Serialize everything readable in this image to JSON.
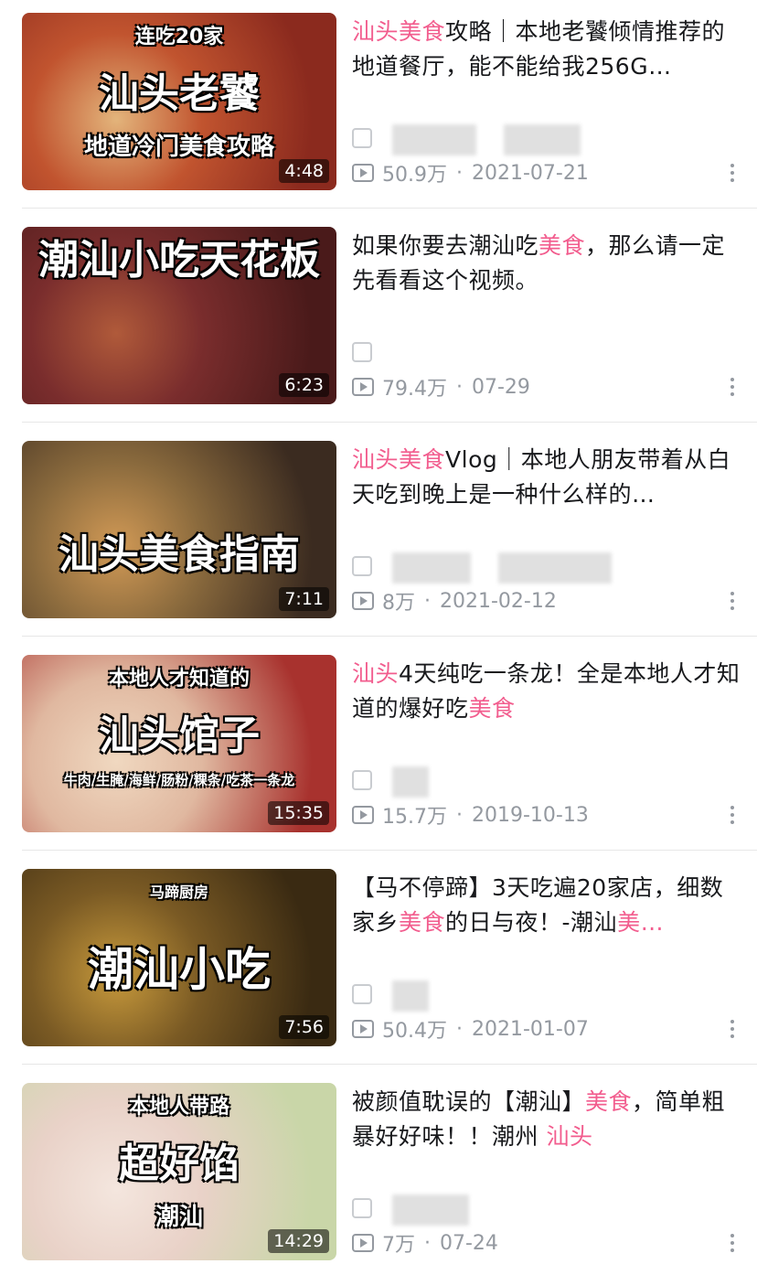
{
  "videos": [
    {
      "title_parts": [
        {
          "t": "汕头美食",
          "hl": true
        },
        {
          "t": "攻略｜本地老饕倾情推荐的地道餐厅，能不能给我256G…",
          "hl": false
        }
      ],
      "thumb_lines": [
        "连吃20家",
        "汕头老饕",
        "地道冷门美食攻略"
      ],
      "duration": "4:48",
      "views": "50.9万",
      "date": "2021-07-21",
      "colors": [
        "#8b2a1e",
        "#c1542f",
        "#e3b47b"
      ]
    },
    {
      "title_parts": [
        {
          "t": "如果你要去潮汕吃",
          "hl": false
        },
        {
          "t": "美食",
          "hl": true
        },
        {
          "t": "，那么请一定先看看这个视频。",
          "hl": false
        }
      ],
      "thumb_lines": [
        "潮汕小吃天花板"
      ],
      "duration": "6:23",
      "views": "79.4万",
      "date": "07-29",
      "colors": [
        "#4a1a1a",
        "#7a2d2d",
        "#b05a3a"
      ]
    },
    {
      "title_parts": [
        {
          "t": "汕头美食",
          "hl": true
        },
        {
          "t": "Vlog｜本地人朋友带着从白天吃到晚上是一种什么样的…",
          "hl": false
        }
      ],
      "thumb_lines": [
        "汕头美食指南"
      ],
      "duration": "7:11",
      "views": "8万",
      "date": "2021-02-12",
      "colors": [
        "#3b2b20",
        "#8a6a3d",
        "#d29a56"
      ]
    },
    {
      "title_parts": [
        {
          "t": "汕头",
          "hl": true
        },
        {
          "t": "4天纯吃一条龙！全是本地人才知道的爆好吃",
          "hl": false
        },
        {
          "t": "美食",
          "hl": true
        }
      ],
      "thumb_lines": [
        "本地人才知道的",
        "汕头馆子",
        "牛肉/生腌/海鲜/肠粉/粿条/吃茶一条龙"
      ],
      "duration": "15:35",
      "views": "15.7万",
      "date": "2019-10-13",
      "colors": [
        "#a8322e",
        "#e0b8a0",
        "#f0d8c0"
      ]
    },
    {
      "title_parts": [
        {
          "t": "【马不停蹄】3天吃遍20家店，细数家乡",
          "hl": false
        },
        {
          "t": "美食",
          "hl": true
        },
        {
          "t": "的日与夜！-潮汕",
          "hl": false
        },
        {
          "t": "美…",
          "hl": true
        }
      ],
      "thumb_lines": [
        "马蹄厨房",
        "潮汕小吃"
      ],
      "duration": "7:56",
      "views": "50.4万",
      "date": "2021-01-07",
      "colors": [
        "#3a2a12",
        "#7a5a24",
        "#c89a3c"
      ]
    },
    {
      "title_parts": [
        {
          "t": "被颜值耽误的【潮汕】",
          "hl": false
        },
        {
          "t": "美食",
          "hl": true
        },
        {
          "t": "，简单粗暴好好味！！潮州 ",
          "hl": false
        },
        {
          "t": "汕头",
          "hl": true
        }
      ],
      "thumb_lines": [
        "本地人带路",
        "超好馅",
        "潮汕"
      ],
      "duration": "14:29",
      "views": "7万",
      "date": "07-24",
      "colors": [
        "#c9d6a8",
        "#e9d2c8",
        "#f4e6de"
      ]
    }
  ]
}
